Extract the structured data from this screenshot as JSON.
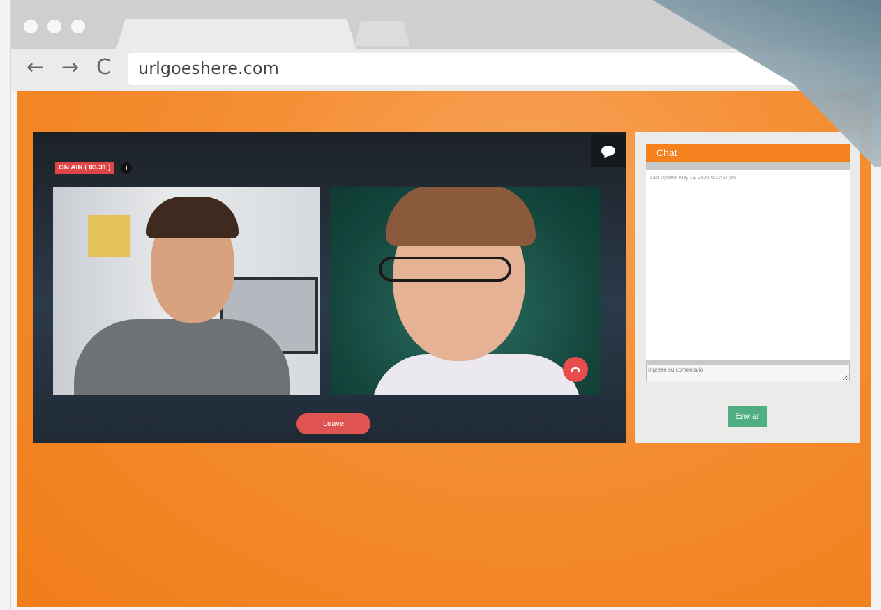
{
  "browser": {
    "url": "urlgoeshere.com",
    "back_icon": "←",
    "forward_icon": "→",
    "reload_icon": "C"
  },
  "video": {
    "on_air_label": "ON AIR ( 03.31 )",
    "info_icon": "i",
    "leave_label": "Leave"
  },
  "chat": {
    "title": "Chat",
    "last_update": "Last Update: May 19, 2020, 6:07:57 pm",
    "comment_placeholder": "Ingrese su comentario",
    "send_label": "Enviar"
  },
  "colors": {
    "accent": "#f5811f",
    "danger": "#e04646",
    "send": "#4faf82"
  }
}
